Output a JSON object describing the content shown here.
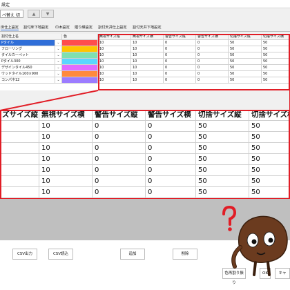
{
  "window": {
    "title": "設定"
  },
  "toolbar": {
    "combo_value": "ペ替え 切",
    "up_label": "▲",
    "down_label": "▼"
  },
  "tabs": [
    "床仕上設定",
    "割付床下地設定",
    "巾木設定",
    "廻り縁設定",
    "割付天井仕上設定",
    "割付天井下地設定"
  ],
  "grid": {
    "headers": [
      "割付仕上名",
      "色",
      "無視サイズ縦",
      "無視サイズ横",
      "警告サイズ縦",
      "警告サイズ横",
      "切捨サイズ縦",
      "切捨サイズ横"
    ],
    "rows": [
      {
        "name": "Pタイル",
        "color": "#ff4d4d",
        "v": [
          "10",
          "10",
          "0",
          "0",
          "50",
          "50"
        ]
      },
      {
        "name": "フローリング",
        "color": "#ffc400",
        "v": [
          "10",
          "10",
          "0",
          "0",
          "50",
          "50"
        ]
      },
      {
        "name": "タイルカーペット",
        "color": "#7fe0b0",
        "v": [
          "10",
          "10",
          "0",
          "0",
          "50",
          "50"
        ]
      },
      {
        "name": "Pタイル300",
        "color": "#5ad6ff",
        "v": [
          "10",
          "10",
          "0",
          "0",
          "50",
          "50"
        ]
      },
      {
        "name": "デザインタイル450",
        "color": "#e06cff",
        "v": [
          "10",
          "10",
          "0",
          "0",
          "50",
          "50"
        ]
      },
      {
        "name": "ウッドタイル100×900",
        "color": "#ff8a3d",
        "v": [
          "10",
          "10",
          "0",
          "0",
          "50",
          "50"
        ]
      },
      {
        "name": "コンパネ12",
        "color": "#9c7cff",
        "v": [
          "10",
          "10",
          "0",
          "0",
          "50",
          "50"
        ]
      }
    ]
  },
  "zoom": {
    "headers": [
      "ズサイズ縦",
      "無視サイズ横",
      "警告サイズ縦",
      "警告サイズ横",
      "切捨サイズ縦",
      "切捨サイズ横"
    ],
    "rows": [
      [
        "",
        "10",
        "0",
        "0",
        "50",
        "50"
      ],
      [
        "",
        "10",
        "0",
        "0",
        "50",
        "50"
      ],
      [
        "",
        "10",
        "0",
        "0",
        "50",
        "50"
      ],
      [
        "",
        "10",
        "0",
        "0",
        "50",
        "50"
      ],
      [
        "",
        "10",
        "0",
        "0",
        "50",
        "50"
      ],
      [
        "",
        "10",
        "0",
        "0",
        "50",
        "50"
      ],
      [
        "",
        "10",
        "0",
        "0",
        "50",
        "50"
      ]
    ]
  },
  "buttons": {
    "csv_out": "CSV出力",
    "csv_in": "CSV読込",
    "add": "追加",
    "delete": "削除",
    "recolor": "色再割り振り",
    "ok": "OK",
    "cancel": "キャ"
  },
  "accent": {
    "red": "#e11d26",
    "select": "#2f6ed8"
  },
  "icons": [
    "question-mark-icon",
    "mascot-character"
  ]
}
